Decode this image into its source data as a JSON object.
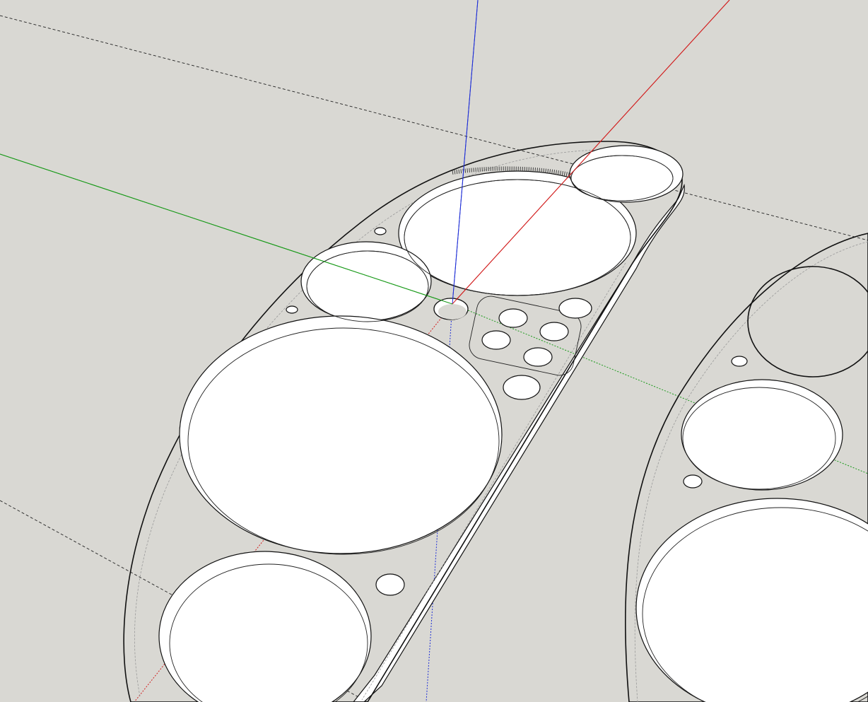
{
  "app": {
    "name": ""
  },
  "viewport": {
    "background_color": "#d9d8d3",
    "model_face_color": "#e8e8e8",
    "edge_color": "#111111",
    "axes": {
      "red": "#d21f1f",
      "green": "#1a9a1a",
      "blue": "#1f2fd6"
    },
    "hidden_guides": "dashed"
  }
}
